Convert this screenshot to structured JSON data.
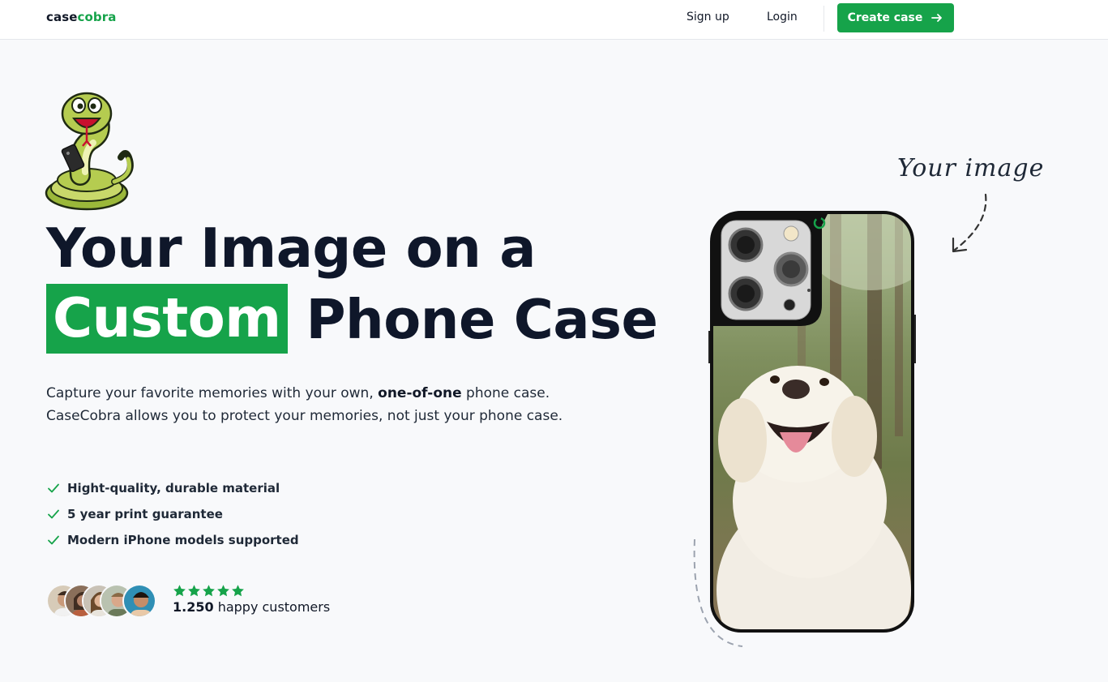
{
  "nav": {
    "logo_part1": "case",
    "logo_part2": "cobra",
    "signup": "Sign up",
    "login": "Login",
    "create_case": "Create case"
  },
  "hero": {
    "headline_line1": "Your Image on a",
    "headline_highlight": "Custom",
    "headline_rest": "Phone Case",
    "description_part1": "Capture your favorite memories with your own, ",
    "description_bold": "one-of-one",
    "description_part2": " phone case. CaseCobra allows you to protect your memories, not just your phone case.",
    "features": [
      "Hight-quality, durable material",
      "5 year print guarantee",
      "Modern iPhone models supported"
    ],
    "rating_stars": 5,
    "customers_count": "1.250",
    "customers_label": " happy customers",
    "your_image_label": "Your image"
  },
  "colors": {
    "brand_green": "#16a34a",
    "text_dark": "#0f172a",
    "background": "#f8f9fb"
  },
  "icons": {
    "check": "check-icon",
    "arrow_right": "arrow-right-icon",
    "star": "star-icon"
  }
}
